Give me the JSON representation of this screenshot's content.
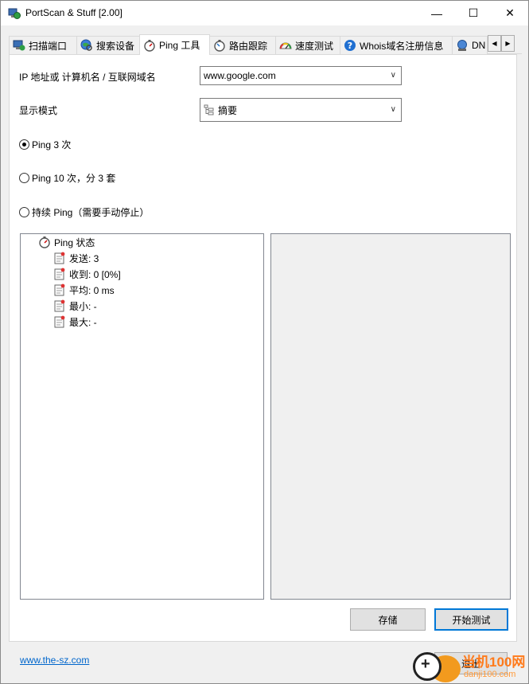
{
  "window": {
    "title": "PortScan & Stuff [2.00]",
    "minimize": "—",
    "maximize": "☐",
    "close": "✕"
  },
  "tabs": [
    {
      "label": "扫描端口",
      "icon": "monitor-globe-icon"
    },
    {
      "label": "搜索设备",
      "icon": "globe-search-icon"
    },
    {
      "label": "Ping 工具",
      "icon": "stopwatch-icon",
      "active": true
    },
    {
      "label": "路由跟踪",
      "icon": "stopwatch-route-icon"
    },
    {
      "label": "速度测试",
      "icon": "speedometer-icon"
    },
    {
      "label": "Whois域名注册信息",
      "icon": "help-circle-icon"
    },
    {
      "label": "DN",
      "icon": "network-globe-icon"
    }
  ],
  "tab_scroll": {
    "left": "◀",
    "right": "▶"
  },
  "ping": {
    "host_label": "IP 地址或 计算机名 / 互联网域名",
    "host_value": "www.google.com",
    "mode_label": "显示模式",
    "mode_value": "摘要",
    "options": [
      {
        "label": "Ping 3 次",
        "checked": true
      },
      {
        "label": "Ping 10 次，分 3 套",
        "checked": false
      },
      {
        "label": "持续 Ping（需要手动停止）",
        "checked": false
      }
    ],
    "tree": {
      "root": "Ping 状态",
      "children": [
        "发送: 3",
        "收到: 0 [0%]",
        "平均: 0 ms",
        "最小: -",
        "最大: -"
      ]
    },
    "save_button": "存储",
    "start_button": "开始测试"
  },
  "footer": {
    "link": "www.the-sz.com",
    "exit_button": "退出"
  },
  "watermark": {
    "line1": "当机100网",
    "line2": "danji100.com"
  },
  "colors": {
    "link": "#0066cc",
    "default_button_border": "#0078d7",
    "watermark": "#ff7a1a"
  }
}
